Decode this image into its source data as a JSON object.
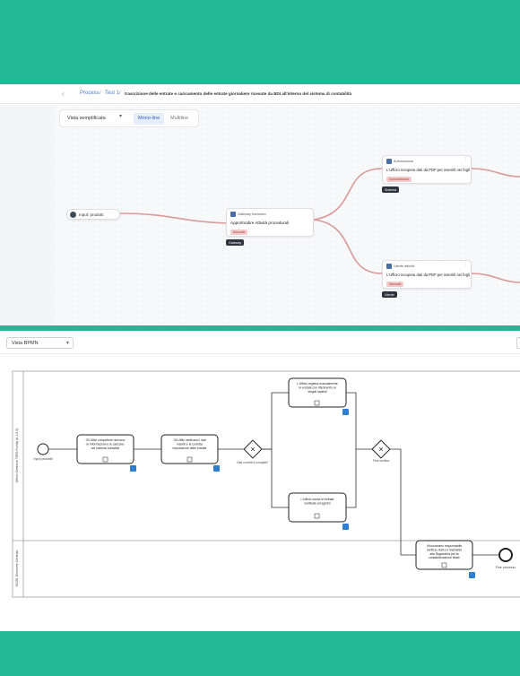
{
  "topbar": {
    "back_icon": "arrow-left-icon",
    "breadcrumb": [
      "Process",
      "Test 1",
      "trascrizione delle entrate e caricamento delle entrate giornaliere ricevute da BDI all'interno del sistema di contabilità"
    ]
  },
  "flow_toolbar": {
    "view_select": "Vista semplificata",
    "segments": [
      "Mono-line",
      "Multiline"
    ]
  },
  "flow": {
    "start": {
      "label": "Input: prodotti",
      "icon": "play-icon"
    },
    "nodes": [
      {
        "type": "Gateway esclusivo",
        "title": "Approfondire  Attività procedurali",
        "tag": "Manuale",
        "chip": "Gateway"
      },
      {
        "type": "Automazione",
        "title": "L'Ufficio recupera dati da PDF per inserirli nei fogli",
        "tag": "Automatizzato",
        "chip": "Sistema"
      },
      {
        "type": "Utente attività",
        "title": "L'Ufficio recupera dati da PDF per inserirli nei fogli",
        "tag": "Manuale",
        "chip": "Utente"
      }
    ]
  },
  "bpmn_bar": {
    "view_select": "Vista BPMN"
  },
  "bpmn": {
    "lanes": [
      "Ufficio Gestione TIRO-Fonda (A 1.0.0)",
      "SCGE Direzione Centrale"
    ],
    "start_label": "Input prodotti",
    "end_label": "Fine processo",
    "tasks": [
      "Gli Uffici competenti ricevono le informazioni e le caricano nel sistema contabile",
      "Gli Uffici verificano i dati inseriti e la corretta imputazione delle entrate",
      "L'Ufficio registra manualmente le entrate con riferimento ai singoli capitoli",
      "L'Ufficio carica le entrate verificate al registro",
      "Il funzionario responsabile verifica i dati e li trasmette alla Ragioneria per la contabilizzazione finale"
    ],
    "gateways": [
      {
        "label": "Dati corretti e completi?"
      },
      {
        "label": "Fine verifica"
      }
    ]
  },
  "colors": {
    "brand": "#22b795",
    "edge": "#d99a9a",
    "task_marker": "#2e7fd1"
  }
}
